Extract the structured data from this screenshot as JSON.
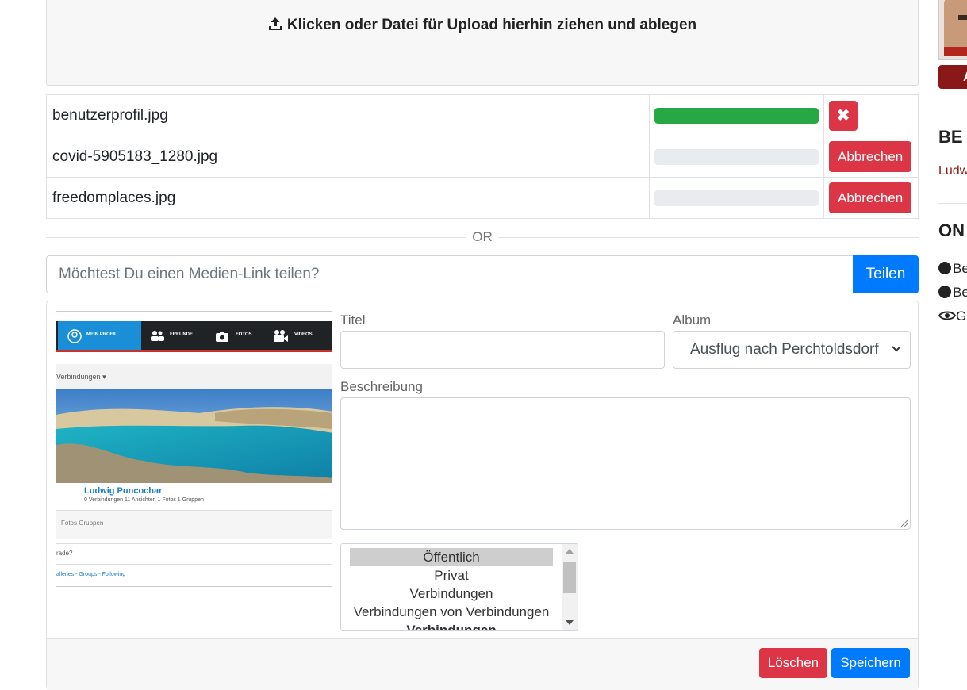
{
  "upload": {
    "dropzone_text": "Klicken oder Datei für Upload hierhin ziehen und ablegen"
  },
  "files": [
    {
      "name": "benutzerprofil.jpg",
      "progress": 1.0,
      "action": "remove"
    },
    {
      "name": "covid-5905183_1280.jpg",
      "progress": 0.0,
      "action_label": "Abbrechen"
    },
    {
      "name": "freedomplaces.jpg",
      "progress": 0.0,
      "action_label": "Abbrechen"
    }
  ],
  "divider": {
    "text": "OR"
  },
  "media_link": {
    "placeholder": "Möchtest Du einen Medien-Link teilen?",
    "value": "",
    "share_label": "Teilen"
  },
  "form": {
    "title_label": "Titel",
    "title_value": "",
    "album_label": "Album",
    "album_value": "Ausflug nach Perchtoldsdorf",
    "description_label": "Beschreibung",
    "description_value": "",
    "privacy_options": [
      "Öffentlich",
      "Privat",
      "Verbindungen",
      "Verbindungen von Verbindungen",
      "Verbindungen"
    ],
    "privacy_selected": "Öffentlich",
    "delete_label": "Löschen",
    "save_label": "Speichern"
  },
  "preview": {
    "nav": [
      "MEIN PROFIL",
      "FREUNDE",
      "FOTOS",
      "VIDEOS"
    ],
    "connections_label": "Verbindungen",
    "profile_name": "Ludwig Puncochar",
    "stats": "0 Verbindungen  11 Ansichten  1 Fotos  1 Gruppen",
    "tabs": "Fotos   Gruppen",
    "question": "rade?",
    "footer_links": "alleries - Groups - Following"
  },
  "sidebar": {
    "button_label": "A",
    "heading_1": "BE",
    "link_1": "Ludw",
    "heading_2": "ON",
    "rows": [
      "Be",
      "Be",
      "G"
    ]
  },
  "colors": {
    "primary": "#007bff",
    "danger": "#dc3545",
    "success": "#28a745",
    "sidebar_accent": "#8a1818"
  }
}
